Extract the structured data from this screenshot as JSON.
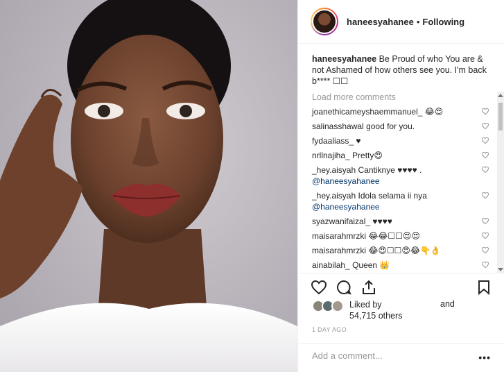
{
  "post": {
    "username": "haneesyahanee",
    "separator": "•",
    "follow_status": "Following",
    "caption": {
      "user": "haneesyahanee",
      "text": "Be Proud of who You are & not Ashamed of how others see you. I'm back b**** ☐☐"
    },
    "load_more": "Load more comments",
    "comments": [
      {
        "user": "joanethicameyshaemmanuel_",
        "text": "😂😍",
        "mention": ""
      },
      {
        "user": "salinasshawal",
        "text": "good for you.",
        "mention": ""
      },
      {
        "user": "fydaaliass_",
        "text": "♥",
        "mention": ""
      },
      {
        "user": "nrllnajiha_",
        "text": "Pretty😍",
        "mention": ""
      },
      {
        "user": "_hey.aisyah",
        "text": "Cantiknye ♥♥♥♥ .",
        "mention": "@haneesyahanee"
      },
      {
        "user": "_hey.aisyah",
        "text": "Idola selama ii nya",
        "mention": "@haneesyahanee"
      },
      {
        "user": "syazwanifaizal_",
        "text": "♥♥♥♥",
        "mention": ""
      },
      {
        "user": "maisarahmrzki",
        "text": "😂😂☐☐😍😍",
        "mention": ""
      },
      {
        "user": "maisarahmrzki",
        "text": "😂😍☐☐😍😂👇👌",
        "mention": ""
      },
      {
        "user": "ainabilah_",
        "text": "Queen 👑",
        "mention": ""
      }
    ],
    "liked_by_label": "Liked by",
    "liked_and": "and",
    "likes_count": "54,715 others",
    "timestamp": "1 DAY AGO",
    "add_comment_placeholder": "Add a comment...",
    "more_options": "•••"
  },
  "icons": {
    "heart": "heart-icon",
    "comment": "comment-icon",
    "share": "share-icon",
    "bookmark": "bookmark-icon"
  },
  "colors": {
    "text": "#262626",
    "muted": "#999999",
    "mention": "#003569",
    "border": "#efefef"
  }
}
